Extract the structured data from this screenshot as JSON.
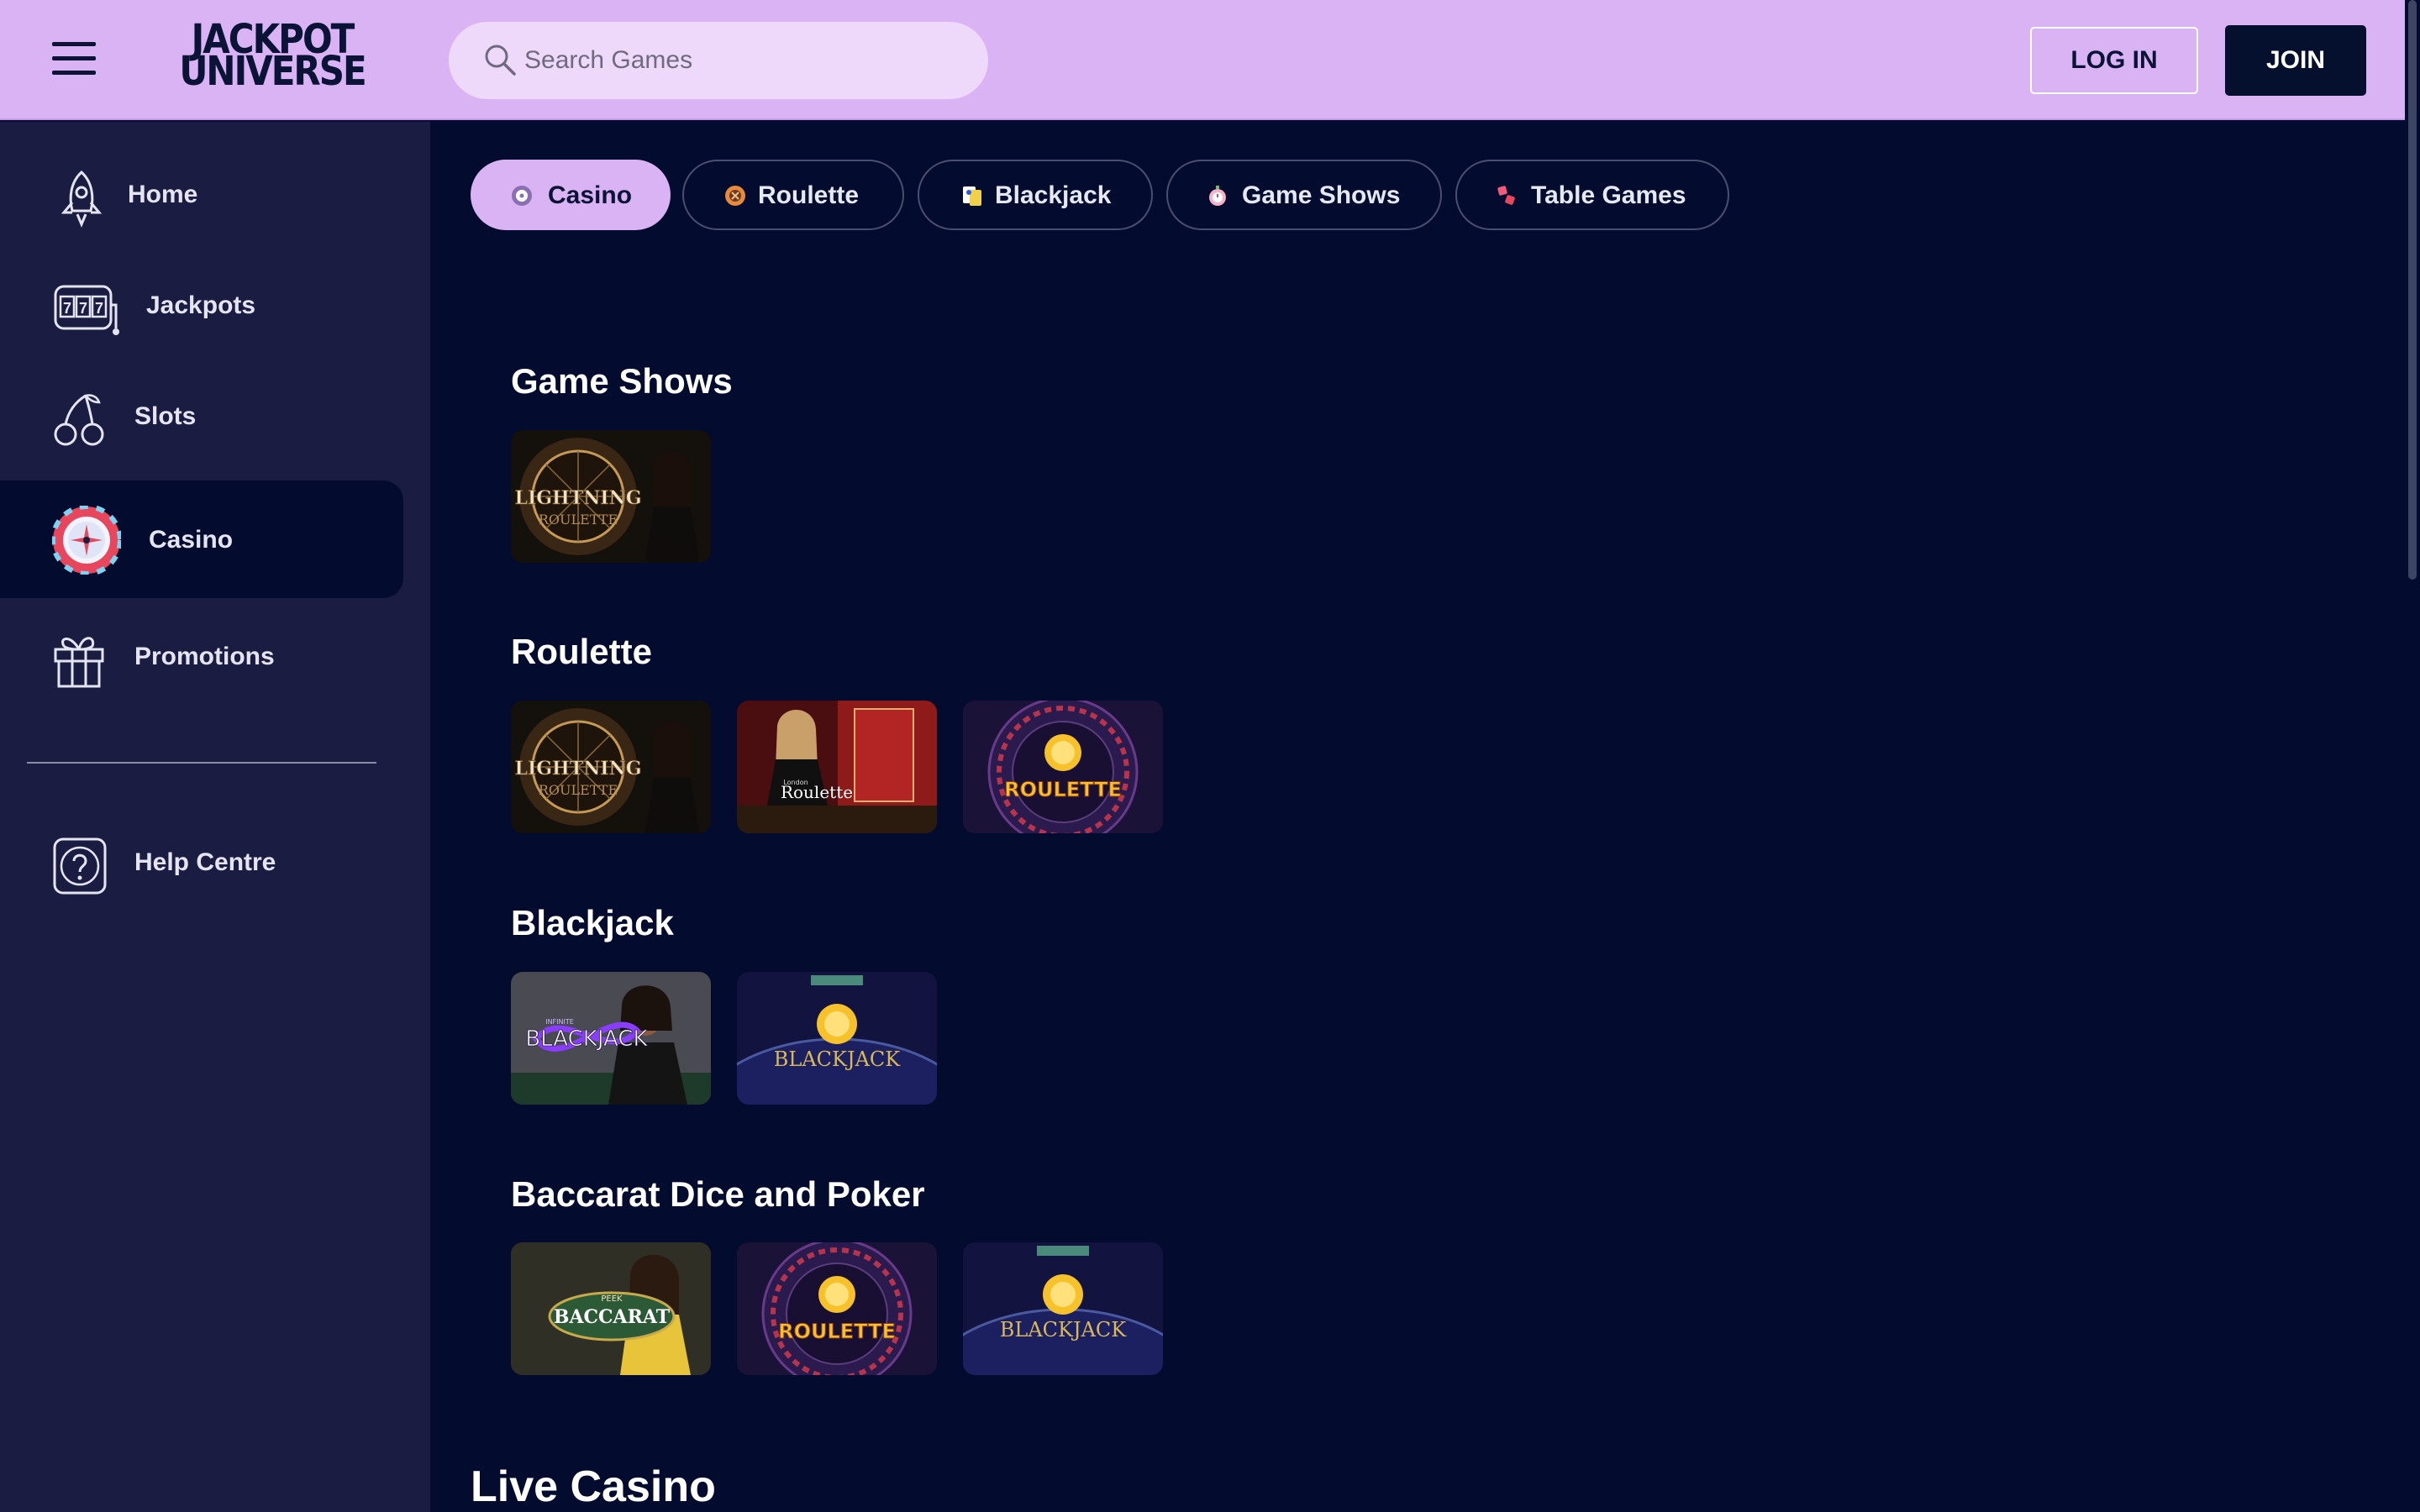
{
  "header": {
    "logo_line1": "JACKPOT",
    "logo_line2": "UNIVERSE",
    "search_placeholder": "Search Games",
    "login_label": "LOG IN",
    "join_label": "JOIN"
  },
  "sidebar": {
    "items": [
      {
        "label": "Home",
        "icon": "rocket-icon"
      },
      {
        "label": "Jackpots",
        "icon": "slot-machine-icon"
      },
      {
        "label": "Slots",
        "icon": "cherries-icon"
      },
      {
        "label": "Casino",
        "icon": "roulette-wheel-icon",
        "active": true
      },
      {
        "label": "Promotions",
        "icon": "gift-icon"
      }
    ],
    "help_label": "Help Centre"
  },
  "tabs": [
    {
      "label": "Casino",
      "icon": "roulette-icon",
      "active": true
    },
    {
      "label": "Roulette",
      "icon": "roulette-chip-icon"
    },
    {
      "label": "Blackjack",
      "icon": "cards-icon"
    },
    {
      "label": "Game Shows",
      "icon": "stopwatch-icon"
    },
    {
      "label": "Table Games",
      "icon": "dice-icon"
    }
  ],
  "sections": [
    {
      "title": "Game Shows",
      "games": [
        {
          "art_text": "LIGHTNING",
          "art_sub": "ROULETTE"
        }
      ]
    },
    {
      "title": "Roulette",
      "games": [
        {
          "art_text": "LIGHTNING",
          "art_sub": "ROULETTE"
        },
        {
          "art_text": "Roulette",
          "art_sub": "London"
        },
        {
          "art_text": "ROULETTE"
        }
      ]
    },
    {
      "title": "Blackjack",
      "games": [
        {
          "art_text": "BLACKJACK",
          "art_sub": "INFINITE"
        },
        {
          "art_text": "BLACKJACK"
        }
      ]
    },
    {
      "title": "Baccarat Dice and Poker",
      "games": [
        {
          "art_text": "BACCARAT",
          "art_sub": "PEEK"
        },
        {
          "art_text": "ROULETTE"
        },
        {
          "art_text": "BLACKJACK"
        }
      ]
    }
  ],
  "live_casino_title": "Live Casino",
  "colors": {
    "header_bg": "#dab3f5",
    "page_bg": "#030b2e",
    "sidebar_bg": "#1a1c42",
    "active_tab": "#dab3f5",
    "join_button": "#05102f"
  }
}
